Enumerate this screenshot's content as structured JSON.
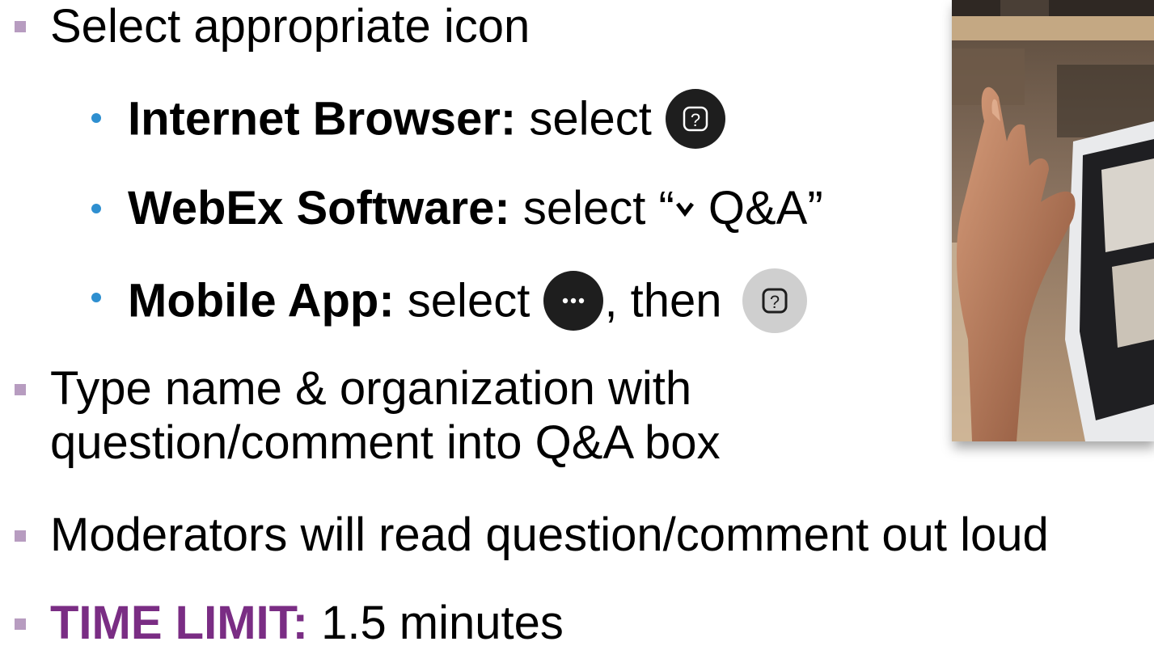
{
  "bullets": {
    "select_icon": "Select appropriate icon",
    "type_line1": "Type name & organization with",
    "type_line2": "question/comment into Q&A box",
    "moderators": "Moderators will read question/comment out loud",
    "time_limit_label": "TIME LIMIT:",
    "time_limit_value": " 1.5 minutes"
  },
  "sub_bullets": {
    "browser_label": "Internet Browser:",
    "browser_text": " select ",
    "webex_label": "WebEx Software:",
    "webex_text": " select “",
    "webex_qa": " Q&A”",
    "mobile_label": "Mobile App:",
    "mobile_text": " select ",
    "mobile_then": ", then "
  },
  "icons": {
    "browser": "question-icon",
    "webex": "chevron-down-icon",
    "mobile_more": "more-dots-icon",
    "mobile_qa": "question-icon"
  },
  "colors": {
    "square_bullet": "#b79cc0",
    "round_bullet": "#2e8fd0",
    "time_limit": "#7a2d84"
  }
}
